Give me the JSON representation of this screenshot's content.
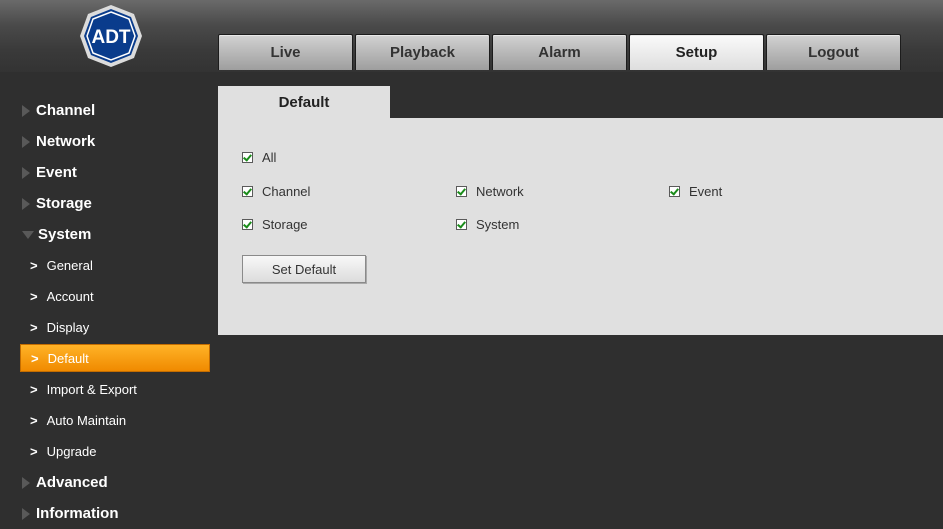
{
  "brand": {
    "logo_text": "ADT",
    "logo_color": "#0a3c8c"
  },
  "nav": {
    "tabs": [
      {
        "label": "Live",
        "active": false
      },
      {
        "label": "Playback",
        "active": false
      },
      {
        "label": "Alarm",
        "active": false
      },
      {
        "label": "Setup",
        "active": true
      },
      {
        "label": "Logout",
        "active": false
      }
    ]
  },
  "sidebar": {
    "items": [
      {
        "label": "Channel",
        "expanded": false
      },
      {
        "label": "Network",
        "expanded": false
      },
      {
        "label": "Event",
        "expanded": false
      },
      {
        "label": "Storage",
        "expanded": false
      },
      {
        "label": "System",
        "expanded": true
      },
      {
        "label": "Advanced",
        "expanded": false
      },
      {
        "label": "Information",
        "expanded": false
      }
    ],
    "system_sub_items": [
      {
        "label": "General",
        "active": false
      },
      {
        "label": "Account",
        "active": false
      },
      {
        "label": "Display",
        "active": false
      },
      {
        "label": "Default",
        "active": true
      },
      {
        "label": "Import & Export",
        "active": false
      },
      {
        "label": "Auto Maintain",
        "active": false
      },
      {
        "label": "Upgrade",
        "active": false
      }
    ],
    "chevron": ">"
  },
  "content": {
    "tab_label": "Default",
    "checkboxes": {
      "all": {
        "label": "All",
        "checked": true
      },
      "channel": {
        "label": "Channel",
        "checked": true
      },
      "network": {
        "label": "Network",
        "checked": true
      },
      "event": {
        "label": "Event",
        "checked": true
      },
      "storage": {
        "label": "Storage",
        "checked": true
      },
      "system": {
        "label": "System",
        "checked": true
      }
    },
    "set_default_button": "Set Default"
  },
  "colors": {
    "accent": "#f5a000",
    "background": "#2f2f2f",
    "panel": "#e0e0e0"
  }
}
